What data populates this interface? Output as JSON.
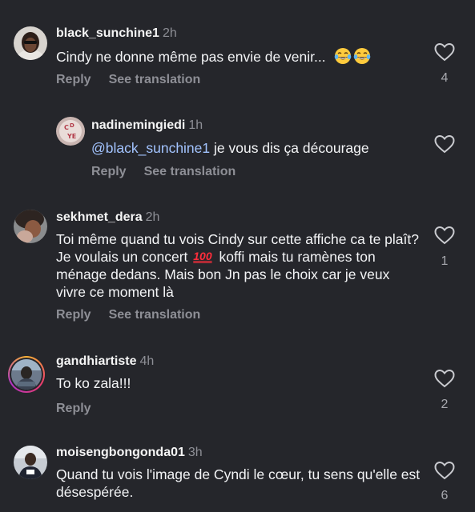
{
  "comments": [
    {
      "username": "black_sunchine1",
      "time": "2h",
      "text": "Cindy ne donne même pas envie de venir...",
      "emojis": [
        "tears-of-joy",
        "tears-of-joy"
      ],
      "reply_label": "Reply",
      "see_translation_label": "See translation",
      "likes": "4"
    },
    {
      "username": "nadinemingiedi",
      "time": "1h",
      "mention": "@black_sunchine1",
      "text": " je vous dis ça décourage",
      "reply_label": "Reply",
      "see_translation_label": "See translation"
    },
    {
      "username": "sekhmet_dera",
      "time": "2h",
      "text_part1": "Toi même quand tu vois Cindy sur cette affiche ca te plaît? Je voulais un concert ",
      "emoji": "100",
      "text_part2": " koffi mais tu ramènes ton ménage dedans. Mais bon Jn pas le choix car je veux vivre ce moment là",
      "reply_label": "Reply",
      "see_translation_label": "See translation",
      "likes": "1"
    },
    {
      "username": "gandhiartiste",
      "time": "4h",
      "text": "To ko zala!!!",
      "reply_label": "Reply",
      "likes": "2"
    },
    {
      "username": "moisengbongonda01",
      "time": "3h",
      "text": "Quand tu vois l'image de Cyndi le cœur, tu sens qu'elle est désespérée.",
      "likes": "6"
    }
  ],
  "icons": {
    "heart": "heart-outline-icon",
    "emoji_laugh": "tears-of-joy-emoji",
    "emoji_100": "hundred-points-emoji"
  },
  "colors": {
    "background": "#25262b",
    "text": "#f3f4f6",
    "secondary": "#8e8f96",
    "mention": "#a3c4ff"
  }
}
